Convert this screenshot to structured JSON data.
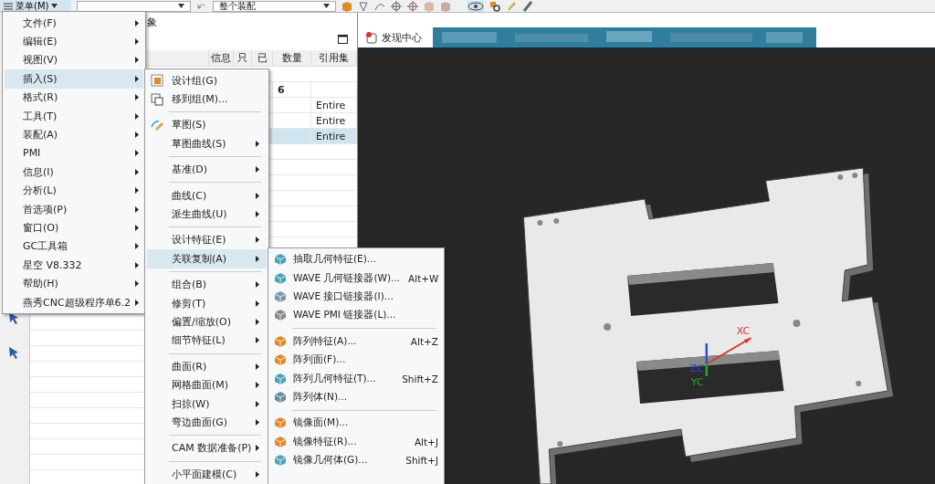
{
  "toolbar": {
    "menu_button": "菜单(M)",
    "assembly_dropdown": "整个装配"
  },
  "panel": {
    "title": "象",
    "table": {
      "columns": [
        "信息",
        "只",
        "已",
        "数量",
        "引用集"
      ],
      "rows": [
        {
          "quantity": "6",
          "selected": false
        },
        {
          "reference_set": "Entire",
          "selected": false
        },
        {
          "reference_set": "Entire",
          "selected": false
        },
        {
          "reference_set": "Entire",
          "selected": true
        }
      ]
    }
  },
  "viewport": {
    "tab": "发现中心",
    "triad": {
      "x": "XC",
      "z": "ZC",
      "y": "YC"
    }
  },
  "main_menu": {
    "items": [
      {
        "label": "文件(F)",
        "selected": false
      },
      {
        "label": "编辑(E)",
        "selected": false
      },
      {
        "label": "视图(V)",
        "selected": false
      },
      {
        "label": "插入(S)",
        "selected": true
      },
      {
        "label": "格式(R)",
        "selected": false
      },
      {
        "label": "工具(T)",
        "selected": false
      },
      {
        "label": "装配(A)",
        "selected": false
      },
      {
        "label": "PMI",
        "selected": false
      },
      {
        "label": "信息(I)",
        "selected": false
      },
      {
        "label": "分析(L)",
        "selected": false
      },
      {
        "label": "首选项(P)",
        "selected": false
      },
      {
        "label": "窗口(O)",
        "selected": false
      },
      {
        "label": "GC工具箱",
        "selected": false
      },
      {
        "label": "星空 V8.332",
        "selected": false
      },
      {
        "label": "帮助(H)",
        "selected": false
      },
      {
        "label": "燕秀CNC超级程序单6.2",
        "selected": false
      }
    ]
  },
  "insert_menu": {
    "groups": [
      [
        {
          "label": "设计组(G)",
          "kind": "command",
          "selected": false
        },
        {
          "label": "移到组(M)...",
          "kind": "command",
          "selected": false
        }
      ],
      [
        {
          "label": "草图(S)",
          "kind": "command",
          "selected": false
        },
        {
          "label": "草图曲线(S)",
          "kind": "submenu",
          "selected": false
        }
      ],
      [
        {
          "label": "基准(D)",
          "kind": "submenu",
          "selected": false
        }
      ],
      [
        {
          "label": "曲线(C)",
          "kind": "submenu",
          "selected": false
        },
        {
          "label": "派生曲线(U)",
          "kind": "submenu",
          "selected": false
        }
      ],
      [
        {
          "label": "设计特征(E)",
          "kind": "submenu",
          "selected": false
        },
        {
          "label": "关联复制(A)",
          "kind": "submenu",
          "selected": true
        }
      ],
      [
        {
          "label": "组合(B)",
          "kind": "submenu",
          "selected": false
        },
        {
          "label": "修剪(T)",
          "kind": "submenu",
          "selected": false
        },
        {
          "label": "偏置/缩放(O)",
          "kind": "submenu",
          "selected": false
        },
        {
          "label": "细节特征(L)",
          "kind": "submenu",
          "selected": false
        }
      ],
      [
        {
          "label": "曲面(R)",
          "kind": "submenu",
          "selected": false
        },
        {
          "label": "网格曲面(M)",
          "kind": "submenu",
          "selected": false
        },
        {
          "label": "扫掠(W)",
          "kind": "submenu",
          "selected": false
        },
        {
          "label": "弯边曲面(G)",
          "kind": "submenu",
          "selected": false
        }
      ],
      [
        {
          "label": "CAM 数据准备(P)",
          "kind": "submenu",
          "selected": false
        }
      ],
      [
        {
          "label": "小平面建模(C)",
          "kind": "submenu",
          "selected": false
        }
      ]
    ]
  },
  "copy_menu": {
    "groups": [
      [
        {
          "label": "抽取几何特征(E)..."
        },
        {
          "label": "WAVE 几何链接器(W)...",
          "shortcut": "Alt+W"
        },
        {
          "label": "WAVE 接口链接器(I)..."
        },
        {
          "label": "WAVE PMI 链接器(L)..."
        }
      ],
      [
        {
          "label": "阵列特征(A)...",
          "shortcut": "Alt+Z"
        },
        {
          "label": "阵列面(F)..."
        },
        {
          "label": "阵列几何特征(T)...",
          "shortcut": "Shift+Z"
        },
        {
          "label": "阵列体(N)..."
        }
      ],
      [
        {
          "label": "镜像面(M)..."
        },
        {
          "label": "镜像特征(R)...",
          "shortcut": "Alt+J"
        },
        {
          "label": "镜像几何体(G)...",
          "shortcut": "Shift+J"
        }
      ]
    ]
  }
}
